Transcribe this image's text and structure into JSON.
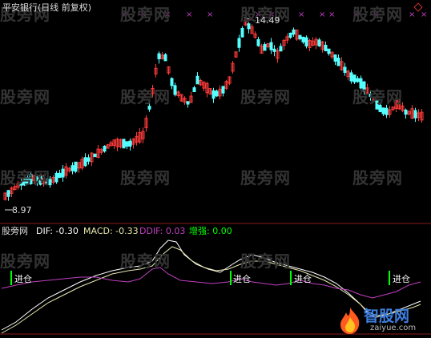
{
  "header": {
    "security_title": "平安银行(日线 前复权)"
  },
  "price_panel": {
    "high_label": "14.49",
    "low_label": "8.97",
    "up_color": "#ff3b3b",
    "down_color": "#54ffff",
    "marker_symbol": "×",
    "marker_color": "#c040c0"
  },
  "indicator": {
    "name": "股旁网",
    "dif_label": "DIF: -0.30",
    "macd_label": "MACD: -0.33",
    "ddif_label": "DDIF: 0.03",
    "zengqiang_label": "增强: 0.00",
    "signal_text": "进仓",
    "dif_color": "#ffffff",
    "macd_color": "#e8e8b0",
    "ddif_color": "#c040c0",
    "signal_color": "#00ff00"
  },
  "watermark": {
    "text": "股旁网",
    "logo_brand": "智股网",
    "logo_url": "zaiyue.com"
  }
}
